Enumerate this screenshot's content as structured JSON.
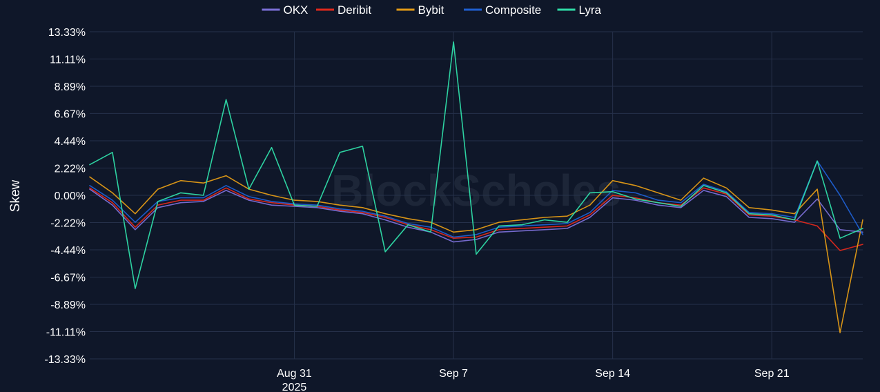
{
  "watermark": "BlockScholes",
  "chart_data": {
    "type": "line",
    "title": "",
    "xlabel": "",
    "ylabel": "Skew",
    "ylim": [
      -13.33,
      13.33
    ],
    "y_ticks": [
      13.33,
      11.11,
      8.89,
      6.67,
      4.44,
      2.22,
      0.0,
      -2.22,
      -4.44,
      -6.67,
      -8.89,
      -11.11,
      -13.33
    ],
    "y_tick_labels": [
      "13.33%",
      "11.11%",
      "8.89%",
      "6.67%",
      "4.44%",
      "2.22%",
      "0.00%",
      "-2.22%",
      "-4.44%",
      "-6.67%",
      "-8.89%",
      "-11.11%",
      "-13.33%"
    ],
    "x_range": [
      "2025-08-22",
      "2025-09-25"
    ],
    "x_ticks": [
      {
        "date": "2025-08-31",
        "label": "Aug 31",
        "sublabel": "2025"
      },
      {
        "date": "2025-09-07",
        "label": "Sep 7",
        "sublabel": ""
      },
      {
        "date": "2025-09-14",
        "label": "Sep 14",
        "sublabel": ""
      },
      {
        "date": "2025-09-21",
        "label": "Sep 21",
        "sublabel": ""
      }
    ],
    "grid": true,
    "legend_position": "top-center",
    "series": [
      {
        "name": "OKX",
        "color": "#7b6fd6",
        "x": [
          "2025-08-22",
          "2025-08-23",
          "2025-08-24",
          "2025-08-25",
          "2025-08-26",
          "2025-08-27",
          "2025-08-28",
          "2025-08-29",
          "2025-08-30",
          "2025-08-31",
          "2025-09-01",
          "2025-09-02",
          "2025-09-03",
          "2025-09-04",
          "2025-09-05",
          "2025-09-06",
          "2025-09-07",
          "2025-09-08",
          "2025-09-09",
          "2025-09-10",
          "2025-09-11",
          "2025-09-12",
          "2025-09-13",
          "2025-09-14",
          "2025-09-15",
          "2025-09-16",
          "2025-09-17",
          "2025-09-18",
          "2025-09-19",
          "2025-09-20",
          "2025-09-21",
          "2025-09-22",
          "2025-09-23",
          "2025-09-24",
          "2025-09-25"
        ],
        "y": [
          0.5,
          -0.8,
          -2.8,
          -1.0,
          -0.6,
          -0.5,
          0.4,
          -0.4,
          -0.8,
          -0.9,
          -1.0,
          -1.3,
          -1.5,
          -2.0,
          -2.6,
          -3.0,
          -3.8,
          -3.6,
          -3.0,
          -2.9,
          -2.8,
          -2.7,
          -1.8,
          -0.2,
          -0.4,
          -0.8,
          -1.0,
          0.4,
          -0.1,
          -1.8,
          -1.9,
          -2.2,
          -0.3,
          -2.8,
          -3.0
        ]
      },
      {
        "name": "Deribit",
        "color": "#e0281c",
        "x": [
          "2025-08-22",
          "2025-08-23",
          "2025-08-24",
          "2025-08-25",
          "2025-08-26",
          "2025-08-27",
          "2025-08-28",
          "2025-08-29",
          "2025-08-30",
          "2025-08-31",
          "2025-09-01",
          "2025-09-02",
          "2025-09-03",
          "2025-09-04",
          "2025-09-05",
          "2025-09-06",
          "2025-09-07",
          "2025-09-08",
          "2025-09-09",
          "2025-09-10",
          "2025-09-11",
          "2025-09-12",
          "2025-09-13",
          "2025-09-14",
          "2025-09-15",
          "2025-09-16",
          "2025-09-17",
          "2025-09-18",
          "2025-09-19",
          "2025-09-20",
          "2025-09-21",
          "2025-09-22",
          "2025-09-23",
          "2025-09-24",
          "2025-09-25"
        ],
        "y": [
          0.6,
          -0.6,
          -2.6,
          -0.8,
          -0.4,
          -0.4,
          0.6,
          -0.3,
          -0.6,
          -0.8,
          -0.9,
          -1.2,
          -1.4,
          -1.8,
          -2.4,
          -2.8,
          -3.5,
          -3.4,
          -2.8,
          -2.7,
          -2.6,
          -2.5,
          -1.6,
          0.0,
          -0.2,
          -0.6,
          -0.8,
          0.6,
          0.1,
          -1.6,
          -1.7,
          -2.0,
          -2.5,
          -4.5,
          -4.0
        ]
      },
      {
        "name": "Bybit",
        "color": "#e39b16",
        "x": [
          "2025-08-22",
          "2025-08-23",
          "2025-08-24",
          "2025-08-25",
          "2025-08-26",
          "2025-08-27",
          "2025-08-28",
          "2025-08-29",
          "2025-08-30",
          "2025-08-31",
          "2025-09-01",
          "2025-09-02",
          "2025-09-03",
          "2025-09-04",
          "2025-09-05",
          "2025-09-06",
          "2025-09-07",
          "2025-09-08",
          "2025-09-09",
          "2025-09-10",
          "2025-09-11",
          "2025-09-12",
          "2025-09-13",
          "2025-09-14",
          "2025-09-15",
          "2025-09-16",
          "2025-09-17",
          "2025-09-18",
          "2025-09-19",
          "2025-09-20",
          "2025-09-21",
          "2025-09-22",
          "2025-09-23",
          "2025-09-24",
          "2025-09-25"
        ],
        "y": [
          1.5,
          0.2,
          -1.5,
          0.5,
          1.2,
          1.0,
          1.6,
          0.5,
          0.0,
          -0.4,
          -0.5,
          -0.8,
          -1.0,
          -1.5,
          -1.9,
          -2.2,
          -3.0,
          -2.8,
          -2.2,
          -2.0,
          -1.8,
          -1.7,
          -0.8,
          1.2,
          0.8,
          0.2,
          -0.4,
          1.4,
          0.6,
          -1.0,
          -1.2,
          -1.5,
          0.5,
          -11.2,
          -2.0
        ]
      },
      {
        "name": "Composite",
        "color": "#1f5fd1",
        "x": [
          "2025-08-22",
          "2025-08-23",
          "2025-08-24",
          "2025-08-25",
          "2025-08-26",
          "2025-08-27",
          "2025-08-28",
          "2025-08-29",
          "2025-08-30",
          "2025-08-31",
          "2025-09-01",
          "2025-09-02",
          "2025-09-03",
          "2025-09-04",
          "2025-09-05",
          "2025-09-06",
          "2025-09-07",
          "2025-09-08",
          "2025-09-09",
          "2025-09-10",
          "2025-09-11",
          "2025-09-12",
          "2025-09-13",
          "2025-09-14",
          "2025-09-15",
          "2025-09-16",
          "2025-09-17",
          "2025-09-18",
          "2025-09-19",
          "2025-09-20",
          "2025-09-21",
          "2025-09-22",
          "2025-09-23",
          "2025-09-24",
          "2025-09-25"
        ],
        "y": [
          0.8,
          -0.4,
          -2.2,
          -0.5,
          -0.2,
          -0.2,
          0.8,
          -0.1,
          -0.5,
          -0.7,
          -0.8,
          -1.1,
          -1.3,
          -1.7,
          -2.3,
          -2.6,
          -3.4,
          -3.2,
          -2.6,
          -2.5,
          -2.4,
          -2.3,
          -1.4,
          0.4,
          0.2,
          -0.4,
          -0.6,
          0.9,
          0.3,
          -1.4,
          -1.5,
          -1.8,
          2.8,
          0.0,
          -3.2
        ]
      },
      {
        "name": "Lyra",
        "color": "#2fdca8",
        "x": [
          "2025-08-22",
          "2025-08-23",
          "2025-08-24",
          "2025-08-25",
          "2025-08-26",
          "2025-08-27",
          "2025-08-28",
          "2025-08-29",
          "2025-08-30",
          "2025-08-31",
          "2025-09-01",
          "2025-09-02",
          "2025-09-03",
          "2025-09-04",
          "2025-09-05",
          "2025-09-06",
          "2025-09-07",
          "2025-09-08",
          "2025-09-09",
          "2025-09-10",
          "2025-09-11",
          "2025-09-12",
          "2025-09-13",
          "2025-09-14",
          "2025-09-15",
          "2025-09-16",
          "2025-09-17",
          "2025-09-18",
          "2025-09-19",
          "2025-09-20",
          "2025-09-21",
          "2025-09-22",
          "2025-09-23",
          "2025-09-24",
          "2025-09-25"
        ],
        "y": [
          2.5,
          3.5,
          -7.6,
          -0.5,
          0.2,
          0.0,
          7.8,
          0.5,
          3.9,
          -0.8,
          -0.9,
          3.5,
          4.0,
          -4.6,
          -2.4,
          -3.0,
          12.5,
          -4.8,
          -2.5,
          -2.4,
          -2.0,
          -2.2,
          0.2,
          0.3,
          -0.3,
          -0.6,
          -0.9,
          0.8,
          0.2,
          -1.5,
          -1.6,
          -2.0,
          2.8,
          -3.5,
          -2.7
        ]
      }
    ]
  }
}
